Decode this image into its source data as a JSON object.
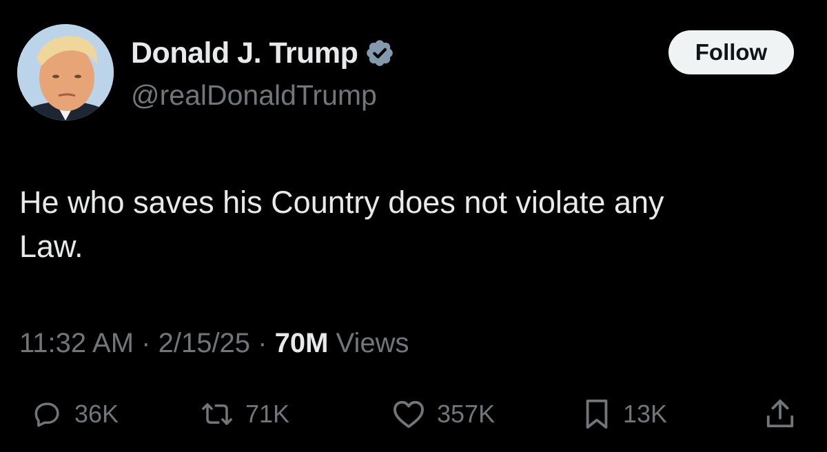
{
  "author": {
    "display_name": "Donald J. Trump",
    "handle": "@realDonaldTrump",
    "verified": true
  },
  "follow_button": {
    "label": "Follow"
  },
  "tweet": {
    "text": "He who saves his Country does not violate any\nLaw."
  },
  "meta": {
    "time": "11:32 AM",
    "separator": " · ",
    "date": "2/15/25",
    "views_count": "70M",
    "views_label": " Views"
  },
  "actions": {
    "replies": "36K",
    "reposts": "71K",
    "likes": "357K",
    "bookmarks": "13K"
  },
  "colors": {
    "background": "#000000",
    "primary_text": "#e7e9ea",
    "secondary_text": "#71767b",
    "verified_badge": "#829aab",
    "follow_button_bg": "#eff3f4"
  },
  "icons": {
    "verified": "verified-badge-icon",
    "reply": "reply-icon",
    "repost": "repost-icon",
    "like": "heart-icon",
    "bookmark": "bookmark-icon",
    "share": "share-icon"
  }
}
